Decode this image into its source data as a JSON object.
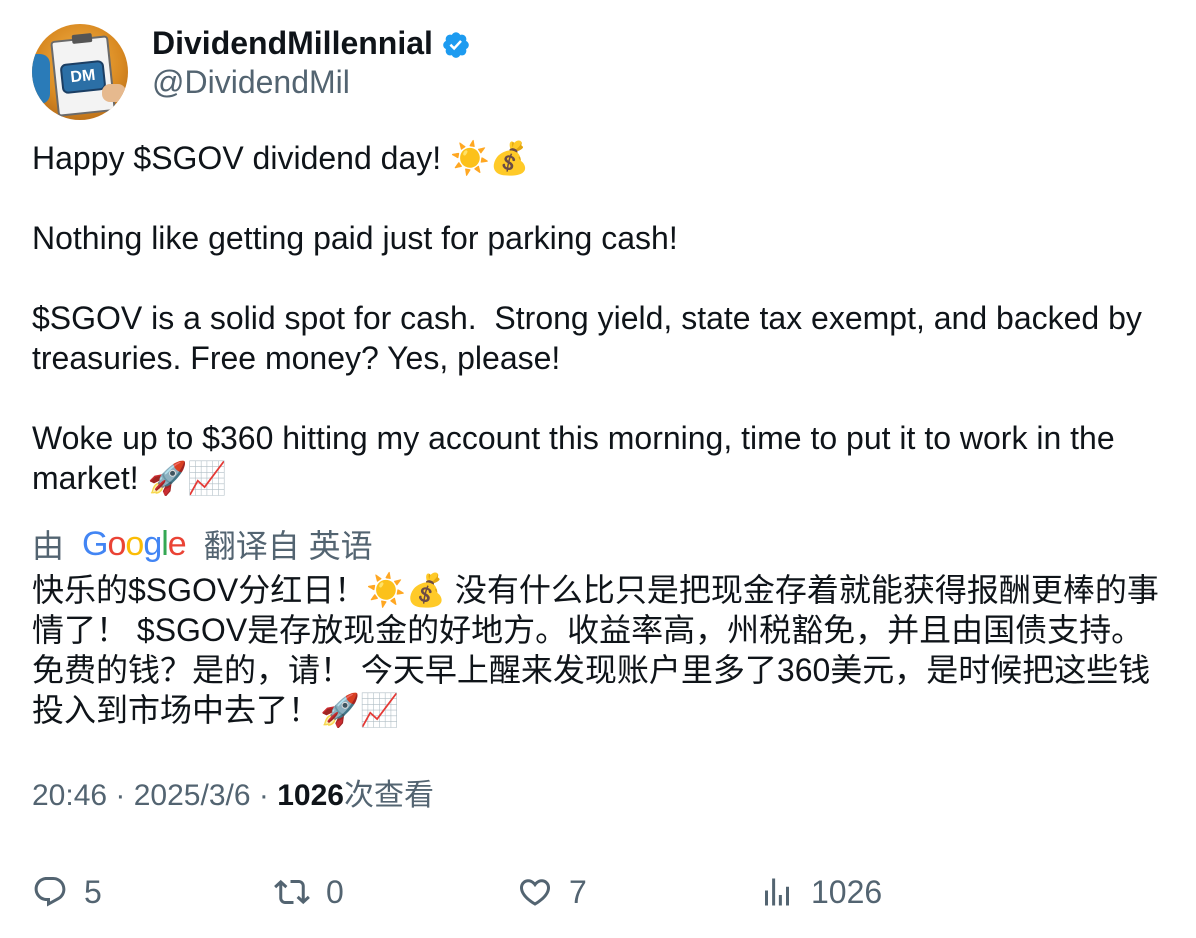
{
  "author": {
    "display_name": "DividendMillennial",
    "handle": "@DividendMil",
    "avatar_text": "DM",
    "verified": true
  },
  "tweet": {
    "text": "Happy $SGOV dividend day! ☀️💰\n\nNothing like getting paid just for parking cash!\n\n$SGOV is a solid spot for cash.  Strong yield, state tax exempt, and backed by\ntreasuries. Free money? Yes, please!\n\nWoke up to $360 hitting my account this morning, time to put it to work in the\nmarket! 🚀📈"
  },
  "translation": {
    "prefix": "由",
    "provider_letters": [
      "G",
      "o",
      "o",
      "g",
      "l",
      "e"
    ],
    "suffix": "翻译自 英语",
    "text": "快乐的$SGOV分红日！☀️💰 没有什么比只是把现金存着就能获得报酬更棒的事\n情了！ $SGOV是存放现金的好地方。收益率高，州税豁免，并且由国债支持。\n免费的钱？是的，请！ 今天早上醒来发现账户里多了360美元，是时候把这些钱\n投入到市场中去了！🚀📈"
  },
  "meta": {
    "time": "20:46",
    "separator": " · ",
    "date": "2025/3/6",
    "views_count": "1026",
    "views_label": "次查看"
  },
  "actions": {
    "replies": "5",
    "retweets": "0",
    "likes": "7",
    "views": "1026"
  },
  "colors": {
    "text_primary": "#0f1419",
    "text_secondary": "#536471",
    "verified_blue": "#1d9bf0"
  },
  "icons": {
    "verified": "verified-badge-icon",
    "reply": "reply-icon",
    "retweet": "retweet-icon",
    "like": "heart-icon",
    "views": "views-chart-icon"
  }
}
